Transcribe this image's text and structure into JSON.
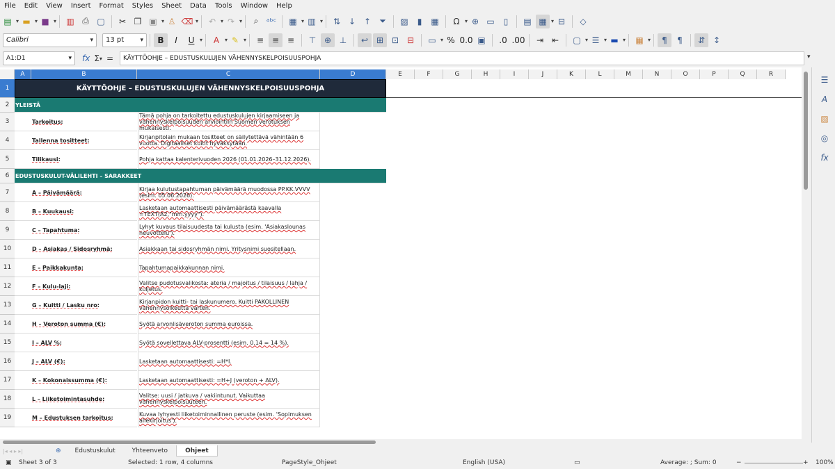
{
  "menu": [
    "File",
    "Edit",
    "View",
    "Insert",
    "Format",
    "Styles",
    "Sheet",
    "Data",
    "Tools",
    "Window",
    "Help"
  ],
  "font_name": "Calibri",
  "font_size": "13 pt",
  "cell_ref": "A1:D1",
  "formula": "KÄYTTÖOHJE – EDUSTUSKULUJEN VÄHENNYSKELPOISUUSPOHJA",
  "columns": [
    "A",
    "B",
    "C",
    "D",
    "E",
    "F",
    "G",
    "H",
    "I",
    "J",
    "K",
    "L",
    "M",
    "N",
    "O",
    "P",
    "Q",
    "R"
  ],
  "title": "KÄYTTÖOHJE – EDUSTUSKULUJEN VÄHENNYSKELPOISUUSPOHJA",
  "section1": "YLEISTÄ",
  "section2": "EDUSTUSKULUT-VÄLILEHTI – SARAKKEET",
  "rows": [
    {
      "num": "1"
    },
    {
      "num": "2"
    },
    {
      "num": "3",
      "label": "Tarkoitus:",
      "text": "Tämä pohja on tarkoitettu edustuskulujen kirjaamiseen ja vähennyskelpoisuuden arviointiin Suomen verotuksen mukaisesti."
    },
    {
      "num": "4",
      "label": "Tallenna tositteet:",
      "text": "Kirjanpitolain mukaan tositteet on säilytettävä vähintään 6 vuotta. Digitaaliset kuitit hyväksytään."
    },
    {
      "num": "5",
      "label": "Tilikausi:",
      "text": "Pohja kattaa kalenterivuoden 2026 (01.01.2026–31.12.2026)."
    },
    {
      "num": "6"
    },
    {
      "num": "7",
      "label": "A – Päivämäärä:",
      "text": "Kirjaa kulutustapahtuman päivämäärä muodossa PP.KK.VVVV (esim. 05.06.2026)."
    },
    {
      "num": "8",
      "label": "B – Kuukausi:",
      "text": "Lasketaan automaattisesti päivämäärästä kaavalla =TEXT(A2,\"mm.yyyy\")."
    },
    {
      "num": "9",
      "label": "C – Tapahtuma:",
      "text": "Lyhyt kuvaus tilaisuudesta tai kulusta (esim. 'Asiakaslounas neuvottelu')."
    },
    {
      "num": "10",
      "label": "D – Asiakas / Sidosryhmä:",
      "text": "Asiakkaan tai sidosryhmän nimi. Yritysnimi suositellaan."
    },
    {
      "num": "11",
      "label": "E – Paikkakunta:",
      "text": "Tapahtumapaikkakunnan nimi."
    },
    {
      "num": "12",
      "label": "F – Kulu-laji:",
      "text": "Valitse pudotusvalikosta: ateria / majoitus / tilaisuus / lahja / kuljetus."
    },
    {
      "num": "13",
      "label": "G – Kuitti / Lasku nro:",
      "text": "Kirjanpidon kuitti- tai laskunumero. Kuitti PAKOLLINEN vähennysoikeutta varten."
    },
    {
      "num": "14",
      "label": "H – Veroton summa (€):",
      "text": "Syötä arvonlisäveroton summa euroissa."
    },
    {
      "num": "15",
      "label": "I – ALV %:",
      "text": "Syötä sovellettava ALV-prosentti (esim. 0.14 = 14 %)."
    },
    {
      "num": "16",
      "label": "J – ALV (€):",
      "text": "Lasketaan automaattisesti: =H*I."
    },
    {
      "num": "17",
      "label": "K – Kokonaissumma (€):",
      "text": "Lasketaan automaattisesti: =H+J (veroton + ALV)."
    },
    {
      "num": "18",
      "label": "L – Liiketoimintasuhde:",
      "text": "Valitse: uusi / jatkuva / vakiintunut. Vaikuttaa vähennyskelpoisuuteen."
    },
    {
      "num": "19",
      "label": "M – Edustuksen tarkoitus:",
      "text": "Kuvaa lyhyesti liiketoiminnallinen peruste (esim. 'Sopimuksen allekirjoitus')."
    }
  ],
  "tabs": [
    "Edustuskulut",
    "Yhteenveto",
    "Ohjeet"
  ],
  "status": {
    "sheet": "Sheet 3 of 3",
    "selected": "Selected: 1 row, 4 columns",
    "pagestyle": "PageStyle_Ohjeet",
    "lang": "English (USA)",
    "sum": "Average: ; Sum: 0",
    "zoom": "100%"
  },
  "colors": {
    "title_bg": "#1f2a3a",
    "section_bg": "#1a7a72",
    "selected": "#3a7cd0"
  }
}
